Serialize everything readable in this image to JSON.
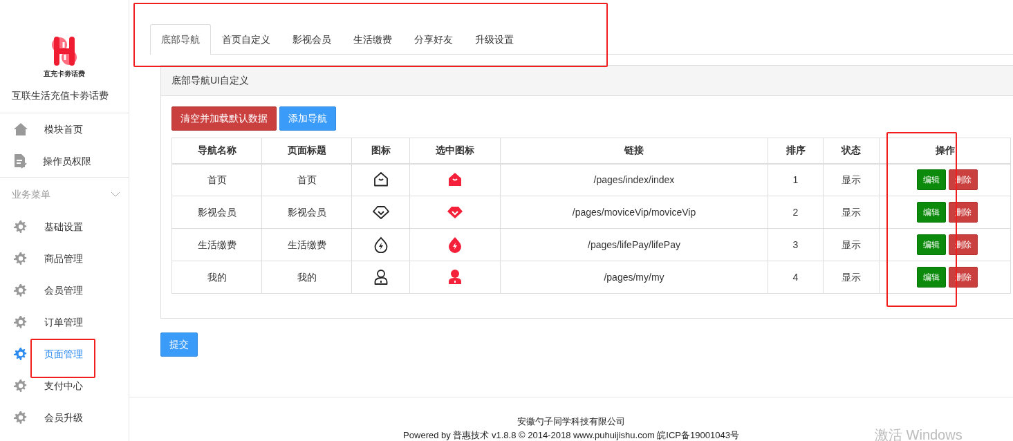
{
  "sidebar": {
    "logo_caption": "直充卡劵话费",
    "app_title": "互联生活充值卡劵话费",
    "top_items": [
      {
        "label": "模块首页",
        "selected": false
      },
      {
        "label": "操作员权限",
        "selected": false
      }
    ],
    "section": {
      "label": "业务菜单",
      "expanded": true
    },
    "items": [
      {
        "label": "基础设置",
        "selected": false,
        "annotated": false
      },
      {
        "label": "商品管理",
        "selected": false,
        "annotated": false
      },
      {
        "label": "会员管理",
        "selected": false,
        "annotated": false
      },
      {
        "label": "订单管理",
        "selected": false,
        "annotated": false
      },
      {
        "label": "页面管理",
        "selected": true,
        "annotated": true
      },
      {
        "label": "支付中心",
        "selected": false,
        "annotated": false
      },
      {
        "label": "会员升级",
        "selected": false,
        "annotated": false
      }
    ]
  },
  "tabs_annotated": true,
  "tabs": [
    {
      "label": "底部导航",
      "selected": true
    },
    {
      "label": "首页自定义",
      "selected": false
    },
    {
      "label": "影视会员",
      "selected": false
    },
    {
      "label": "生活缴费",
      "selected": false
    },
    {
      "label": "分享好友",
      "selected": false
    },
    {
      "label": "升级设置",
      "selected": false
    }
  ],
  "panel": {
    "title": "底部导航UI自定义",
    "reset_button": "清空并加载默认数据",
    "add_button": "添加导航"
  },
  "table": {
    "columns": [
      "导航名称",
      "页面标题",
      "图标",
      "选中图标",
      "链接",
      "排序",
      "状态",
      "操作"
    ],
    "actions_annotated": true,
    "rows": [
      {
        "name": "首页",
        "title": "首页",
        "link": "/pages/index/index",
        "order": "1",
        "status": "显示",
        "edit": "编辑",
        "delete": "删除"
      },
      {
        "name": "影视会员",
        "title": "影视会员",
        "link": "/pages/moviceVip/moviceVip",
        "order": "2",
        "status": "显示",
        "edit": "编辑",
        "delete": "删除"
      },
      {
        "name": "生活缴费",
        "title": "生活缴费",
        "link": "/pages/lifePay/lifePay",
        "order": "3",
        "status": "显示",
        "edit": "编辑",
        "delete": "删除"
      },
      {
        "name": "我的",
        "title": "我的",
        "link": "/pages/my/my",
        "order": "4",
        "status": "显示",
        "edit": "编辑",
        "delete": "删除"
      }
    ]
  },
  "submit_button": "提交",
  "footer": {
    "company": "安徽勺子同学科技有限公司",
    "powered": "Powered by 普惠技术 v1.8.8 © 2014-2018 www.puhuijishu.com 皖ICP备19001043号"
  },
  "os_watermark": "激活 Windows"
}
